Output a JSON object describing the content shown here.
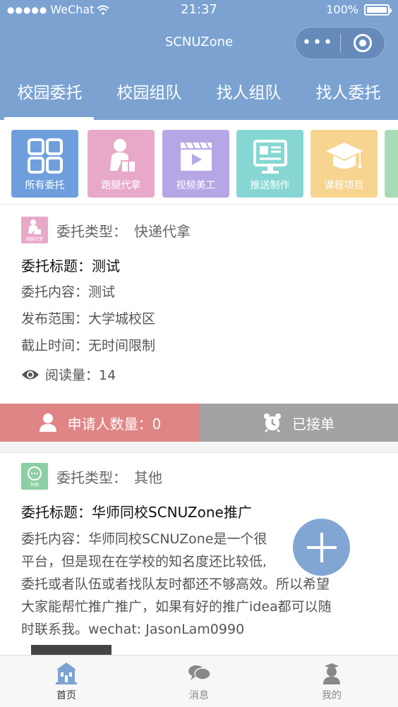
{
  "statusbar": {
    "carrier": "WeChat",
    "time": "21:37",
    "battery": "100%"
  },
  "navbar": {
    "title": "SCNUZone",
    "more_glyph": "•••"
  },
  "tabs": [
    {
      "label": "校园委托",
      "active": true
    },
    {
      "label": "校园组队",
      "active": false
    },
    {
      "label": "找人组队",
      "active": false
    },
    {
      "label": "找人委托",
      "active": false
    }
  ],
  "categories": [
    {
      "label": "所有委托",
      "color": "#6e9fdc",
      "icon": "grid-icon"
    },
    {
      "label": "跑腿代拿",
      "color": "#e7a9c7",
      "icon": "delivery-person-icon"
    },
    {
      "label": "视频美工",
      "color": "#b7a6e5",
      "icon": "video-icon"
    },
    {
      "label": "推送制作",
      "color": "#86d7d3",
      "icon": "screen-icon"
    },
    {
      "label": "课程项目",
      "color": "#f7d48f",
      "icon": "graduation-cap-icon"
    }
  ],
  "posts": [
    {
      "type_label": "委托类型：",
      "type_value": "快递代拿",
      "badge_text": "跑腿代拿",
      "title": "委托标题：测试",
      "content": "委托内容：测试",
      "scope": "发布范围：大学城校区",
      "deadline": "截止时间：无时间限制",
      "reads": "阅读量：14",
      "applicants": "申请人数量：0",
      "status": "已接单"
    },
    {
      "type_label": "委托类型：",
      "type_value": "其他",
      "badge_text": "其他",
      "title": "委托标题：华师同校SCNUZone推广",
      "content_lines": [
        "委托内容：华师同校SCNUZone是一个很",
        "平台，但是现在在学校的知名度还比较低,",
        "委托或者队伍或者找队友时都还不够高效。所以希望",
        "大家能帮忙推广推广，如果有好的推广idea都可以随",
        "时联系我。wechat: JasonLam0990"
      ]
    }
  ],
  "bottom_tabs": [
    {
      "label": "首页",
      "icon": "home-icon",
      "active": true
    },
    {
      "label": "消息",
      "icon": "chat-icon",
      "active": false
    },
    {
      "label": "我的",
      "icon": "profile-icon",
      "active": false
    }
  ],
  "colors": {
    "primary": "#7ba2d1",
    "apply": "#e08585",
    "taken": "#a3a3a3"
  }
}
